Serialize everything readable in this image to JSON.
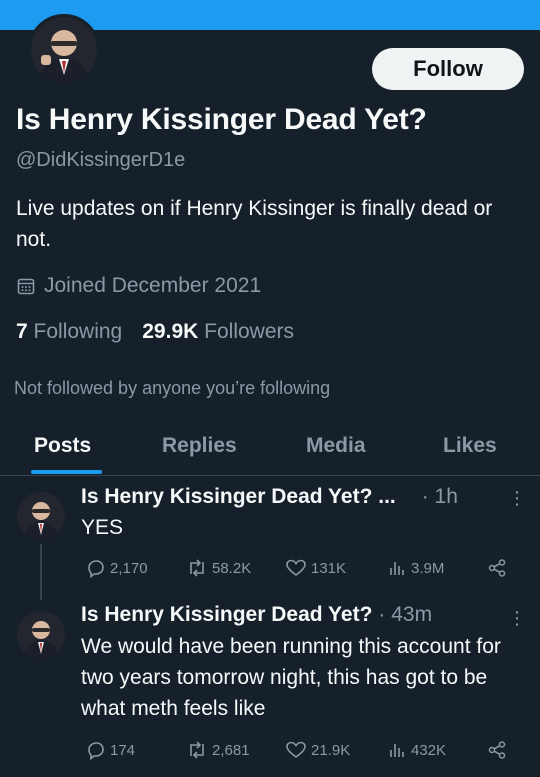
{
  "profile": {
    "name": "Is Henry Kissinger Dead Yet?",
    "handle": "@DidKissingerD1e",
    "bio": "Live updates on if Henry Kissinger is finally dead or not.",
    "joined": "Joined December 2021",
    "following_count": "7",
    "following_label": "Following",
    "followers_count": "29.9K",
    "followers_label": "Followers",
    "not_followed": "Not followed by anyone you’re following",
    "follow_label": "Follow",
    "banner_color": "#1d9bf0"
  },
  "tabs": [
    {
      "label": "Posts",
      "active": true
    },
    {
      "label": "Replies",
      "active": false
    },
    {
      "label": "Media",
      "active": false
    },
    {
      "label": "Likes",
      "active": false
    }
  ],
  "tweets": [
    {
      "name": "Is Henry Kissinger Dead Yet?",
      "name_trunc": "Is Henry Kissinger Dead Yet? ...",
      "time": "· 1h",
      "text": "YES",
      "replies": "2,170",
      "reposts": "58.2K",
      "likes": "131K",
      "views": "3.9M"
    },
    {
      "name": "Is Henry Kissinger Dead Yet?",
      "time": "· 43m",
      "text": "We would have been running this account for two years tomorrow night, this has got to be what meth feels like",
      "replies": "174",
      "reposts": "2,681",
      "likes": "21.9K",
      "views": "432K"
    }
  ]
}
